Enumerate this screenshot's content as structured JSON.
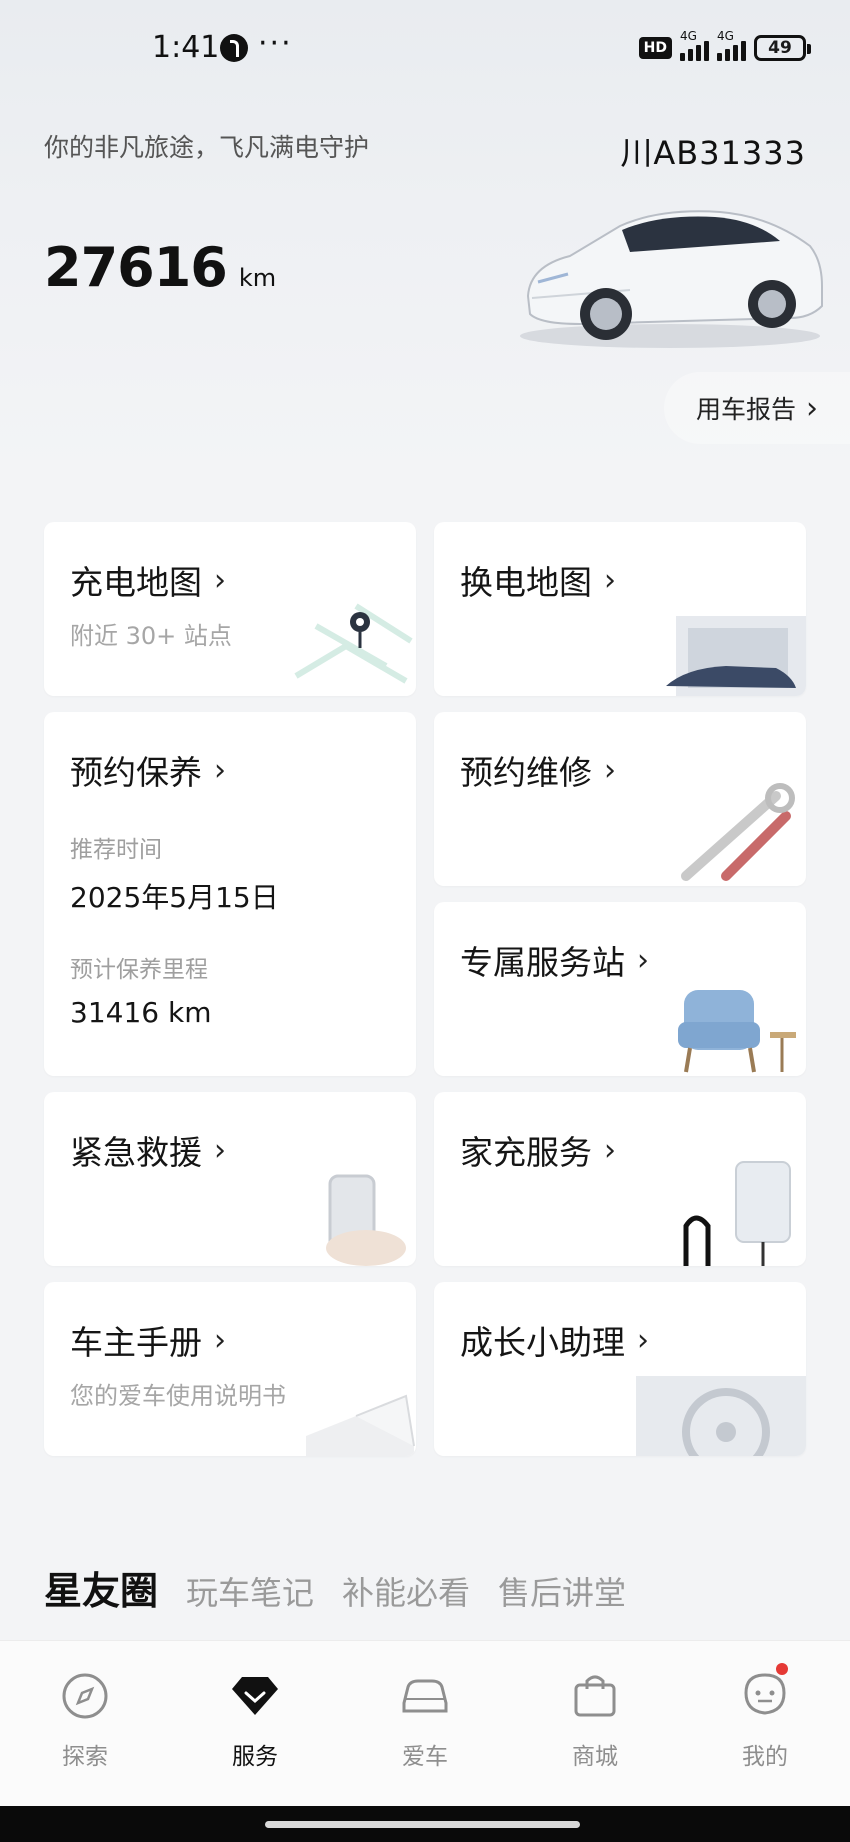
{
  "status_bar": {
    "time": "1:41",
    "more": "···",
    "network_hd": "HD",
    "signal1_type": "4G",
    "signal2_type": "4G",
    "battery": "49"
  },
  "hero": {
    "slogan": "你的非凡旅途，飞凡满电守护",
    "plate": "川AB31333",
    "mileage_value": "27616",
    "mileage_unit": "km",
    "report_label": "用车报告"
  },
  "cards": {
    "charge_map": {
      "title": "充电地图",
      "subtitle": "附近 30+ 站点"
    },
    "swap_map": {
      "title": "换电地图"
    },
    "maintenance": {
      "title": "预约保养",
      "time_label": "推荐时间",
      "time_value": "2025年5月15日",
      "mileage_label": "预计保养里程",
      "mileage_value": "31416 km"
    },
    "repair": {
      "title": "预约维修"
    },
    "service_station": {
      "title": "专属服务站"
    },
    "rescue": {
      "title": "紧急救援"
    },
    "home_charge": {
      "title": "家充服务"
    },
    "manual": {
      "title": "车主手册",
      "subtitle": "您的爱车使用说明书"
    },
    "assistant": {
      "title": "成长小助理"
    }
  },
  "community": {
    "active_tab": "星友圈",
    "tabs": [
      "玩车笔记",
      "补能必看",
      "售后讲堂"
    ]
  },
  "bottom_nav": [
    {
      "label": "探索",
      "icon": "compass-icon"
    },
    {
      "label": "服务",
      "icon": "diamond-icon"
    },
    {
      "label": "爱车",
      "icon": "car-icon"
    },
    {
      "label": "商城",
      "icon": "shopping-bag-icon"
    },
    {
      "label": "我的",
      "icon": "profile-icon"
    }
  ],
  "colors": {
    "accent_dot": "#e53935",
    "background": "#f3f4f6"
  }
}
